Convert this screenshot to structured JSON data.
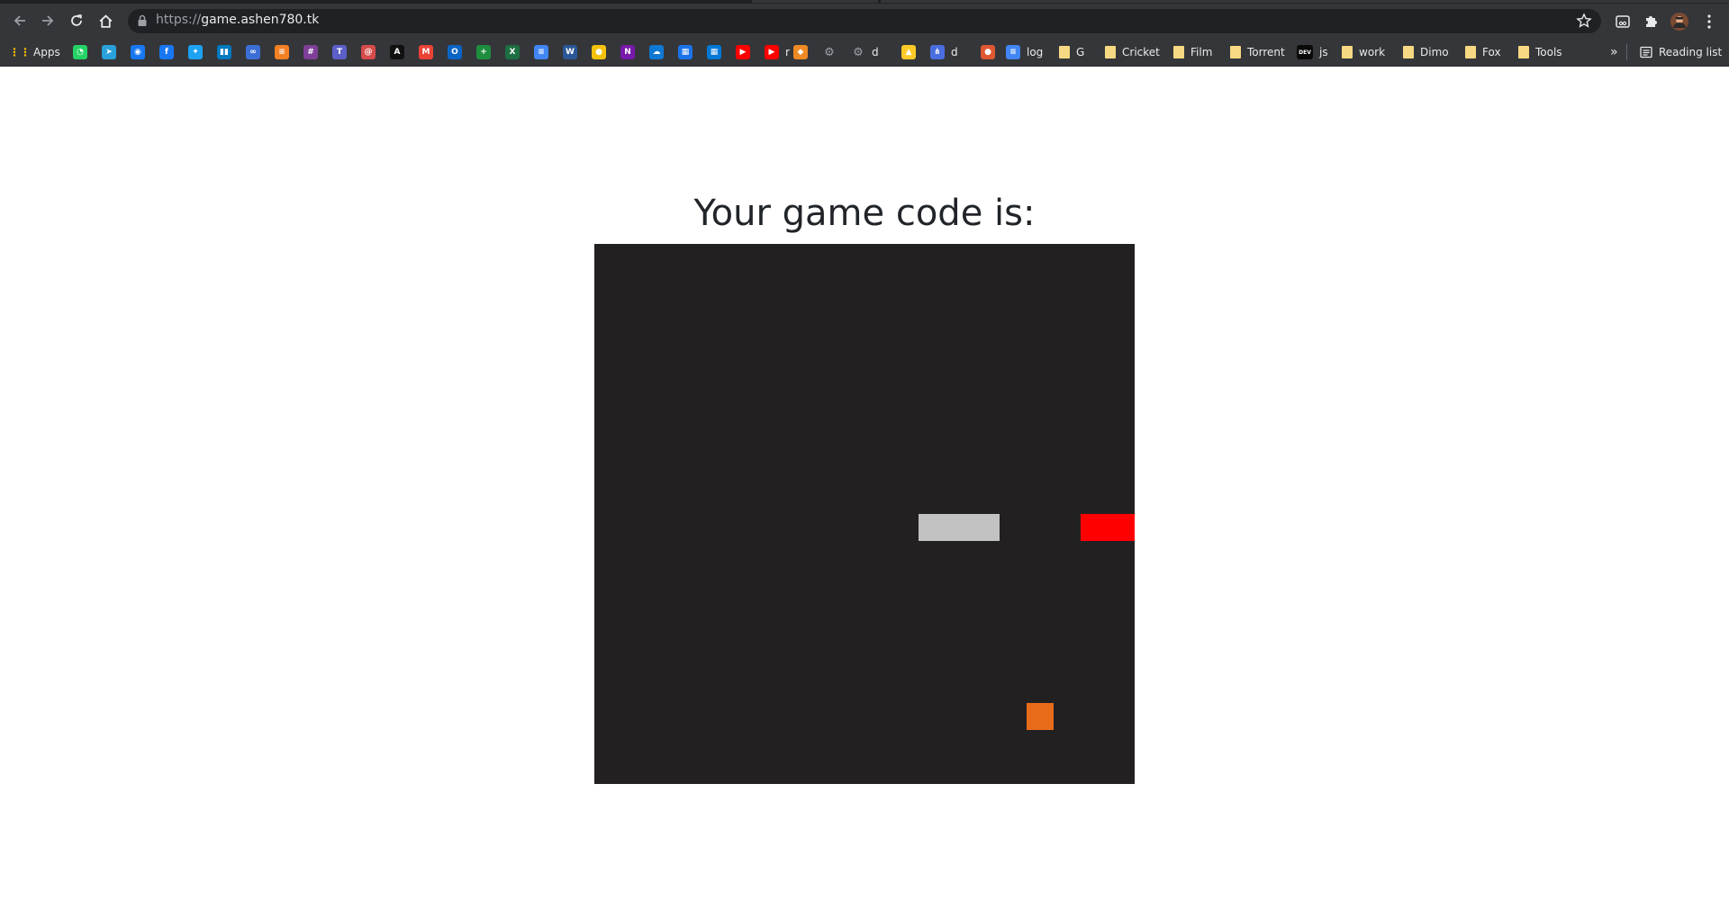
{
  "browser": {
    "url_scheme": "https://",
    "url_host": "game.ashen780.tk",
    "bookmarks": [
      {
        "label": "Apps",
        "icon": "apps-grid-icon",
        "color": "#ea4335"
      },
      {
        "label": "",
        "icon": "whatsapp-icon",
        "color": "#25d366"
      },
      {
        "label": "",
        "icon": "telegram-icon",
        "color": "#2aa1da"
      },
      {
        "label": "",
        "icon": "messenger-icon",
        "color": "#1877f2"
      },
      {
        "label": "",
        "icon": "facebook-icon",
        "color": "#1877f2"
      },
      {
        "label": "",
        "icon": "twitter-icon",
        "color": "#1da1f2"
      },
      {
        "label": "",
        "icon": "trello-icon",
        "color": "#0079bf"
      },
      {
        "label": "",
        "icon": "link-icon",
        "color": "#3c6fd6"
      },
      {
        "label": "",
        "icon": "stackoverflow-icon",
        "color": "#f48024"
      },
      {
        "label": "",
        "icon": "slack-icon",
        "color": "#7f3f98"
      },
      {
        "label": "",
        "icon": "teams-icon",
        "color": "#5b5fc7"
      },
      {
        "label": "",
        "icon": "swirl-icon",
        "color": "#d64b4b"
      },
      {
        "label": "",
        "icon": "angular-icon",
        "color": "#111111"
      },
      {
        "label": "",
        "icon": "gmail-icon",
        "color": "#ea4335"
      },
      {
        "label": "",
        "icon": "outlook-icon",
        "color": "#0a64c5"
      },
      {
        "label": "",
        "icon": "sheets-plus-icon",
        "color": "#1e8e3e"
      },
      {
        "label": "",
        "icon": "excel-icon",
        "color": "#1d6f42"
      },
      {
        "label": "",
        "icon": "docs-icon",
        "color": "#4285f4"
      },
      {
        "label": "",
        "icon": "word-icon",
        "color": "#2b5797"
      },
      {
        "label": "",
        "icon": "keep-icon",
        "color": "#f4c20d"
      },
      {
        "label": "",
        "icon": "onenote-icon",
        "color": "#7719aa"
      },
      {
        "label": "",
        "icon": "onedrive-icon",
        "color": "#0f78d4"
      },
      {
        "label": "",
        "icon": "calendar-icon",
        "color": "#1a73e8"
      },
      {
        "label": "",
        "icon": "windows-icon",
        "color": "#0078d6"
      },
      {
        "label": "",
        "icon": "youtube-icon",
        "color": "#ff0000"
      },
      {
        "label": "r",
        "icon": "youtube-icon",
        "color": "#ff0000"
      },
      {
        "label": "",
        "icon": "box-icon",
        "color": "#f08a24"
      },
      {
        "label": "",
        "icon": "gear-icon",
        "color": "#5f6368"
      },
      {
        "label": "d",
        "icon": "gear-icon",
        "color": "#5f6368"
      },
      {
        "label": "",
        "icon": "firebase-icon",
        "color": "#ffca28"
      },
      {
        "label": "d",
        "icon": "diagram-icon",
        "color": "#4a6ee0"
      },
      {
        "label": "",
        "icon": "duckduckgo-icon",
        "color": "#de5833"
      },
      {
        "label": "log",
        "icon": "docs-icon",
        "color": "#4285f4"
      },
      {
        "label": "G",
        "icon": "folder-icon",
        "color": "#f6d982"
      },
      {
        "label": "Cricket",
        "icon": "folder-icon",
        "color": "#f6d982"
      },
      {
        "label": "Film",
        "icon": "folder-icon",
        "color": "#f6d982"
      },
      {
        "label": "Torrent",
        "icon": "folder-icon",
        "color": "#f6d982"
      },
      {
        "label": "js",
        "icon": "dev-icon",
        "color": "#0a0a0a",
        "badge": "DEV"
      },
      {
        "label": "work",
        "icon": "folder-icon",
        "color": "#f6d982"
      },
      {
        "label": "Dimo",
        "icon": "folder-icon",
        "color": "#f6d982"
      },
      {
        "label": "Fox",
        "icon": "folder-icon",
        "color": "#f6d982"
      },
      {
        "label": "Tools",
        "icon": "folder-icon",
        "color": "#f6d982"
      }
    ],
    "overflow_label": "»",
    "reading_list_label": "Reading list"
  },
  "page": {
    "title": "Your game code is:"
  },
  "game": {
    "background": "#232022",
    "grid_cells": 20,
    "paddle": {
      "color": "#c2c2c2",
      "col": 12,
      "row": 10,
      "width_cells": 3,
      "height_cells": 1
    },
    "opponent": {
      "color": "#ff0000",
      "col": 18,
      "row": 10,
      "width_cells": 2,
      "height_cells": 1
    },
    "food": {
      "color": "#e86b1a",
      "col": 16,
      "row": 17,
      "width_cells": 1,
      "height_cells": 1
    }
  }
}
